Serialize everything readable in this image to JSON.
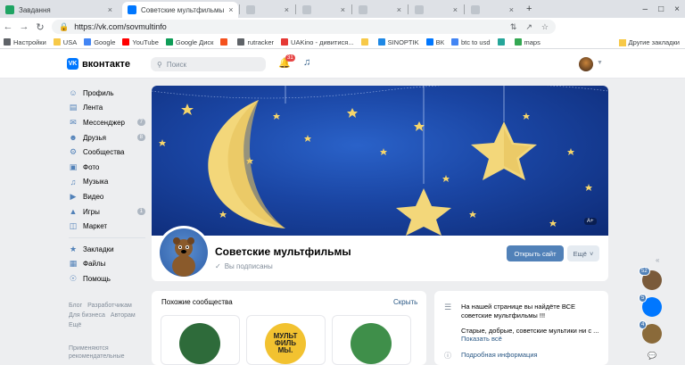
{
  "browser": {
    "tabs": [
      {
        "title": "Завдання",
        "color": "#1fa463",
        "active": false
      },
      {
        "title": "Советские мультфильмы",
        "color": "#0077ff",
        "active": true
      },
      {
        "title": "",
        "color": "#bfc5cc",
        "active": false
      },
      {
        "title": "",
        "color": "#bfc5cc",
        "active": false
      },
      {
        "title": "",
        "color": "#bfc5cc",
        "active": false
      },
      {
        "title": "",
        "color": "#bfc5cc",
        "active": false
      },
      {
        "title": "",
        "color": "#bfc5cc",
        "active": false
      }
    ],
    "url": "https://vk.com/sovmultinfo",
    "bookmarks": [
      {
        "label": "Настройки",
        "color": "#5f6368"
      },
      {
        "label": "USA",
        "color": "#f7c948"
      },
      {
        "label": "Google",
        "color": "#4285f4"
      },
      {
        "label": "YouTube",
        "color": "#ff0000"
      },
      {
        "label": "Google Диск",
        "color": "#0f9d58"
      },
      {
        "label": "",
        "color": "#f4511e"
      },
      {
        "label": "rutracker",
        "color": "#5f6368"
      },
      {
        "label": "UAKino - дивитися...",
        "color": "#e53935"
      },
      {
        "label": "",
        "color": "#f7c948"
      },
      {
        "label": "SINOPTIK",
        "color": "#1e88e5"
      },
      {
        "label": "ВК",
        "color": "#0077ff"
      },
      {
        "label": "btc to usd",
        "color": "#4285f4"
      },
      {
        "label": "",
        "color": "#26a69a"
      },
      {
        "label": "maps",
        "color": "#34a853"
      }
    ],
    "other_bookmarks": "Другие закладки"
  },
  "vk": {
    "logo_text": "вконтакте",
    "logo_mark": "VK",
    "search_placeholder": "Поиск",
    "notifications_count": "31",
    "nav": [
      {
        "label": "Профиль",
        "icon": "user-icon",
        "count": ""
      },
      {
        "label": "Лента",
        "icon": "news-icon",
        "count": ""
      },
      {
        "label": "Мессенджер",
        "icon": "message-icon",
        "count": "7"
      },
      {
        "label": "Друзья",
        "icon": "friends-icon",
        "count": "8"
      },
      {
        "label": "Сообщества",
        "icon": "groups-icon",
        "count": ""
      },
      {
        "label": "Фото",
        "icon": "photo-icon",
        "count": ""
      },
      {
        "label": "Музыка",
        "icon": "music-icon",
        "count": ""
      },
      {
        "label": "Видео",
        "icon": "video-icon",
        "count": ""
      },
      {
        "label": "Игры",
        "icon": "games-icon",
        "count": "1"
      },
      {
        "label": "Маркет",
        "icon": "market-icon",
        "count": ""
      }
    ],
    "nav2": [
      {
        "label": "Закладки",
        "icon": "bookmark-icon"
      },
      {
        "label": "Файлы",
        "icon": "files-icon"
      },
      {
        "label": "Помощь",
        "icon": "help-icon"
      }
    ],
    "footer_links": [
      "Блог",
      "Разработчикам",
      "Для бизнеса",
      "Авторам",
      "Ещё"
    ],
    "footer_note": "Применяются рекомендательные"
  },
  "community": {
    "name": "Советские мультфильмы",
    "status": "Вы подписаны",
    "open_site": "Открыть сайт",
    "more": "Ещё",
    "cover_badge": "A+"
  },
  "similar": {
    "title": "Похожие сообщества",
    "hide": "Скрыть",
    "items": [
      {
        "label": "",
        "color": "#2e6b3a"
      },
      {
        "label": "МУЛЬТ ФИЛЬ МЫ.",
        "color": "#f2c230"
      },
      {
        "label": "",
        "color": "#3f8f4a"
      }
    ]
  },
  "info": {
    "text1": "На нашей странице вы найдёте ВСЕ советские мультфильмы !!!",
    "text2": "Старые, добрые, советские мультики ни с ...",
    "show_all": "Показать всё",
    "details": "Подробная информация"
  },
  "right_rail": [
    {
      "count": "52",
      "color": "#7a5a3a"
    },
    {
      "count": "5",
      "color": "#0077ff"
    },
    {
      "count": "4",
      "color": "#8a6a3a"
    }
  ]
}
